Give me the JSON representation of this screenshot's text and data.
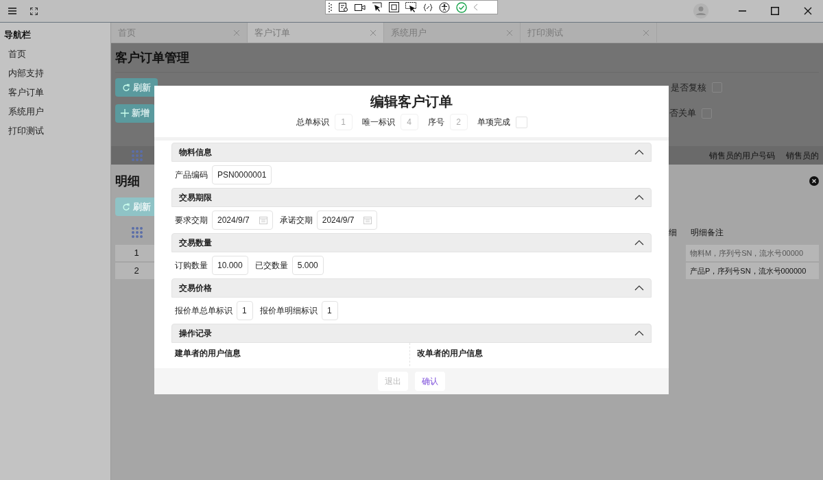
{
  "nav": {
    "title": "导航栏",
    "items": [
      {
        "label": "首页"
      },
      {
        "label": "内部支持"
      },
      {
        "label": "客户订单"
      },
      {
        "label": "系统用户"
      },
      {
        "label": "打印测试"
      }
    ]
  },
  "tabs": [
    {
      "label": "首页",
      "selected": false
    },
    {
      "label": "客户订单",
      "selected": true
    },
    {
      "label": "系统用户",
      "selected": false
    },
    {
      "label": "打印测试",
      "selected": false
    }
  ],
  "page_title": "客户订单管理",
  "toolbar": {
    "refresh": "刷新",
    "add": "新增",
    "checks": [
      {
        "label": "是否复核",
        "checked": false
      },
      {
        "label": "否关单",
        "checked": false
      }
    ]
  },
  "main_table": {
    "columns": [
      "销售员的用户号码",
      "销售员的"
    ]
  },
  "detail": {
    "title": "明细",
    "refresh": "刷新",
    "columns": [
      "细",
      "明细备注"
    ],
    "rows": [
      {
        "index": "1",
        "note": "物料M，序列号SN，流水号00000"
      },
      {
        "index": "2",
        "note": "产品P，序列号SN，流水号000000"
      }
    ]
  },
  "dialog": {
    "title": "编辑客户订单",
    "meta": [
      {
        "label": "总单标识",
        "value": "1",
        "kind": "text"
      },
      {
        "label": "唯一标识",
        "value": "4",
        "kind": "text"
      },
      {
        "label": "序号",
        "value": "2",
        "kind": "text"
      },
      {
        "label": "单项完成",
        "checked": false,
        "kind": "checkbox"
      }
    ],
    "sections": [
      {
        "title": "物料信息",
        "expanded": true,
        "kind": "fields",
        "fields": [
          {
            "label": "产品编码",
            "value": "PSN0000001",
            "kind": "text"
          }
        ]
      },
      {
        "title": "交易期限",
        "expanded": true,
        "kind": "fields",
        "fields": [
          {
            "label": "要求交期",
            "value": "2024/9/7",
            "kind": "date"
          },
          {
            "label": "承诺交期",
            "value": "2024/9/7",
            "kind": "date"
          }
        ]
      },
      {
        "title": "交易数量",
        "expanded": true,
        "kind": "fields",
        "fields": [
          {
            "label": "订购数量",
            "value": "10.000",
            "kind": "text"
          },
          {
            "label": "已交数量",
            "value": "5.000",
            "kind": "text"
          }
        ]
      },
      {
        "title": "交易价格",
        "expanded": true,
        "kind": "fields",
        "fields": [
          {
            "label": "报价单总单标识",
            "value": "1",
            "kind": "text"
          },
          {
            "label": "报价单明细标识",
            "value": "1",
            "kind": "text"
          }
        ]
      },
      {
        "title": "操作记录",
        "expanded": true,
        "kind": "columns",
        "columns": [
          "建单者的用户信息",
          "改单者的用户信息"
        ]
      }
    ],
    "buttons": [
      {
        "label": "退出",
        "disabled": true
      },
      {
        "label": "确认",
        "disabled": false
      }
    ]
  }
}
